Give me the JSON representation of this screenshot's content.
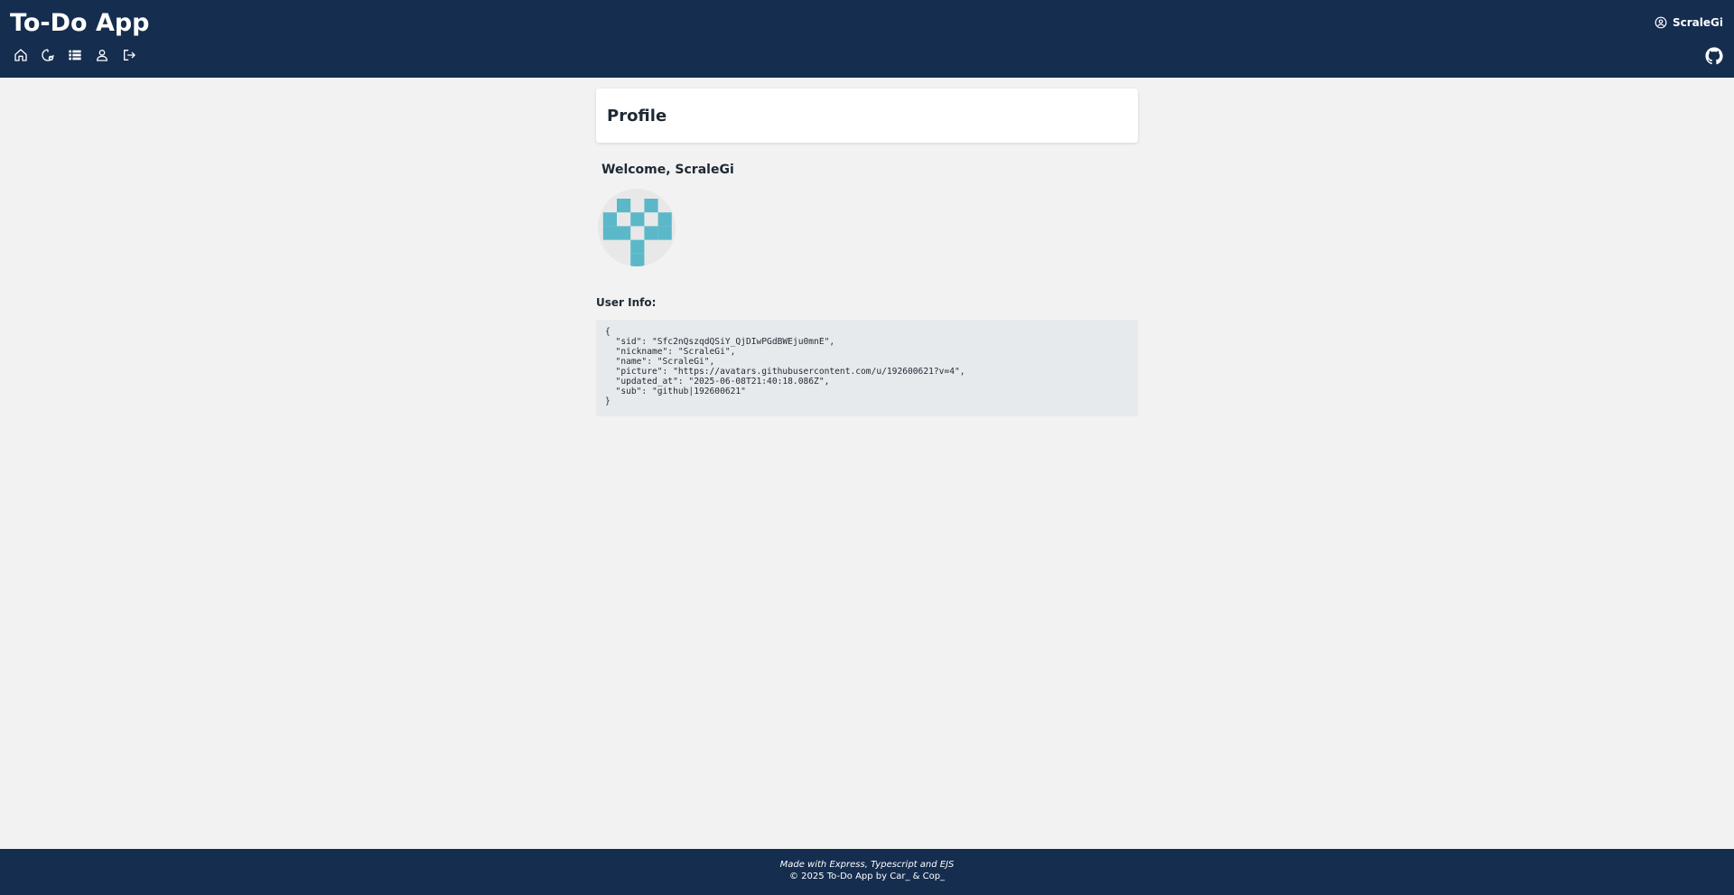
{
  "header": {
    "app_title": "To-Do App",
    "user_name": "ScraleGi",
    "nav_icons": [
      "home-icon",
      "badge-check-icon",
      "list-icon",
      "user-icon",
      "logout-icon"
    ],
    "github_icon": "github-icon"
  },
  "main": {
    "page_title": "Profile",
    "welcome": "Welcome, ScraleGi",
    "avatar_icon": "identicon-avatar",
    "user_info_label": "User Info:",
    "user_info_lines": [
      "{",
      "  \"sid\": \"Sfc2nQszqdQSiY_QjDIwPGdBWEju0mnE\",",
      "  \"nickname\": \"ScraleGi\",",
      "  \"name\": \"ScraleGi\",",
      "  \"picture\": \"https://avatars.githubusercontent.com/u/192600621?v=4\",",
      "  \"updated_at\": \"2025-06-08T21:40:18.086Z\",",
      "  \"sub\": \"github|192600621\"",
      "}"
    ]
  },
  "footer": {
    "made_with": "Made with Express, Typescript and EJS",
    "copyright": "© 2025 To-Do App by Car_ & Cop_"
  },
  "colors": {
    "header_bg": "#152d4f",
    "page_bg": "#f2f2f2",
    "avatar_color": "#5bb8c9",
    "code_bg": "#e7eaed"
  }
}
